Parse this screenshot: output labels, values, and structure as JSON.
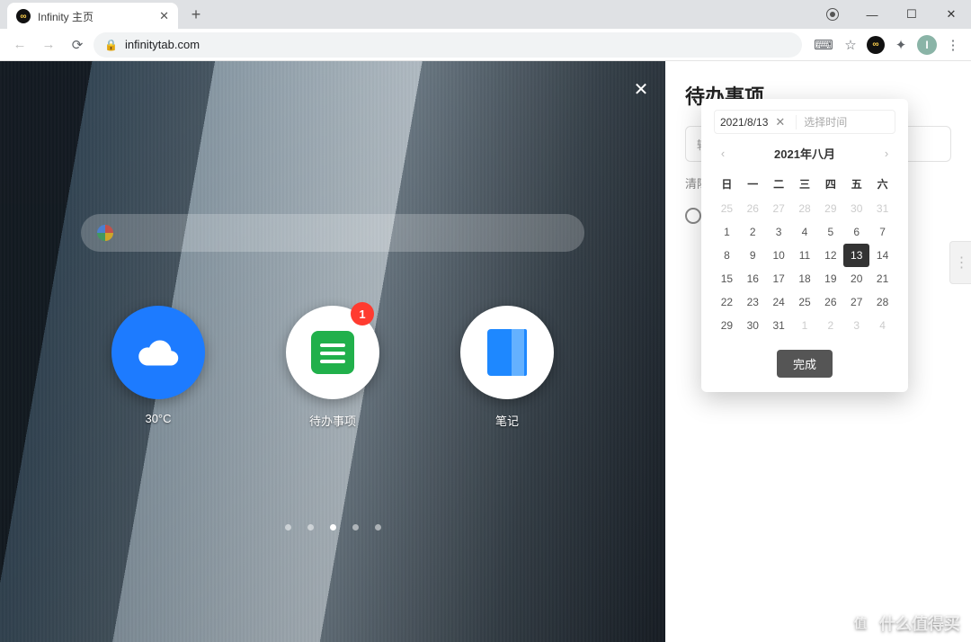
{
  "browser": {
    "tab_title": "Infinity 主页",
    "url": "infinitytab.com",
    "avatar_letter": "I",
    "window_controls": {
      "minimize": "—",
      "maximize": "☐",
      "close": "✕"
    }
  },
  "wallpaper": {
    "close": "✕",
    "apps": [
      {
        "id": "weather",
        "label": "30°C"
      },
      {
        "id": "todo",
        "label": "待办事项",
        "badge": "1"
      },
      {
        "id": "notes",
        "label": "笔记"
      }
    ],
    "dots_total": 5,
    "dots_active_index": 2
  },
  "sidebar": {
    "title": "待办事项",
    "input_placeholder": "输",
    "clear_label": "清除"
  },
  "datepicker": {
    "selected_date": "2021/8/13",
    "time_placeholder": "选择时间",
    "month_title": "2021年八月",
    "prev": "‹",
    "next": "›",
    "clear_icon": "✕",
    "done_label": "完成",
    "weekdays": [
      "日",
      "一",
      "二",
      "三",
      "四",
      "五",
      "六"
    ],
    "grid": [
      [
        {
          "n": 25,
          "m": true
        },
        {
          "n": 26,
          "m": true
        },
        {
          "n": 27,
          "m": true
        },
        {
          "n": 28,
          "m": true
        },
        {
          "n": 29,
          "m": true
        },
        {
          "n": 30,
          "m": true
        },
        {
          "n": 31,
          "m": true
        }
      ],
      [
        {
          "n": 1
        },
        {
          "n": 2
        },
        {
          "n": 3
        },
        {
          "n": 4
        },
        {
          "n": 5
        },
        {
          "n": 6
        },
        {
          "n": 7
        }
      ],
      [
        {
          "n": 8
        },
        {
          "n": 9
        },
        {
          "n": 10
        },
        {
          "n": 11
        },
        {
          "n": 12
        },
        {
          "n": 13,
          "sel": true
        },
        {
          "n": 14
        }
      ],
      [
        {
          "n": 15
        },
        {
          "n": 16
        },
        {
          "n": 17
        },
        {
          "n": 18
        },
        {
          "n": 19
        },
        {
          "n": 20
        },
        {
          "n": 21
        }
      ],
      [
        {
          "n": 22
        },
        {
          "n": 23
        },
        {
          "n": 24
        },
        {
          "n": 25
        },
        {
          "n": 26
        },
        {
          "n": 27
        },
        {
          "n": 28
        }
      ],
      [
        {
          "n": 29
        },
        {
          "n": 30
        },
        {
          "n": 31
        },
        {
          "n": 1,
          "m": true
        },
        {
          "n": 2,
          "m": true
        },
        {
          "n": 3,
          "m": true
        },
        {
          "n": 4,
          "m": true
        }
      ]
    ]
  },
  "watermark": {
    "icon": "值",
    "text": "什么值得买"
  }
}
